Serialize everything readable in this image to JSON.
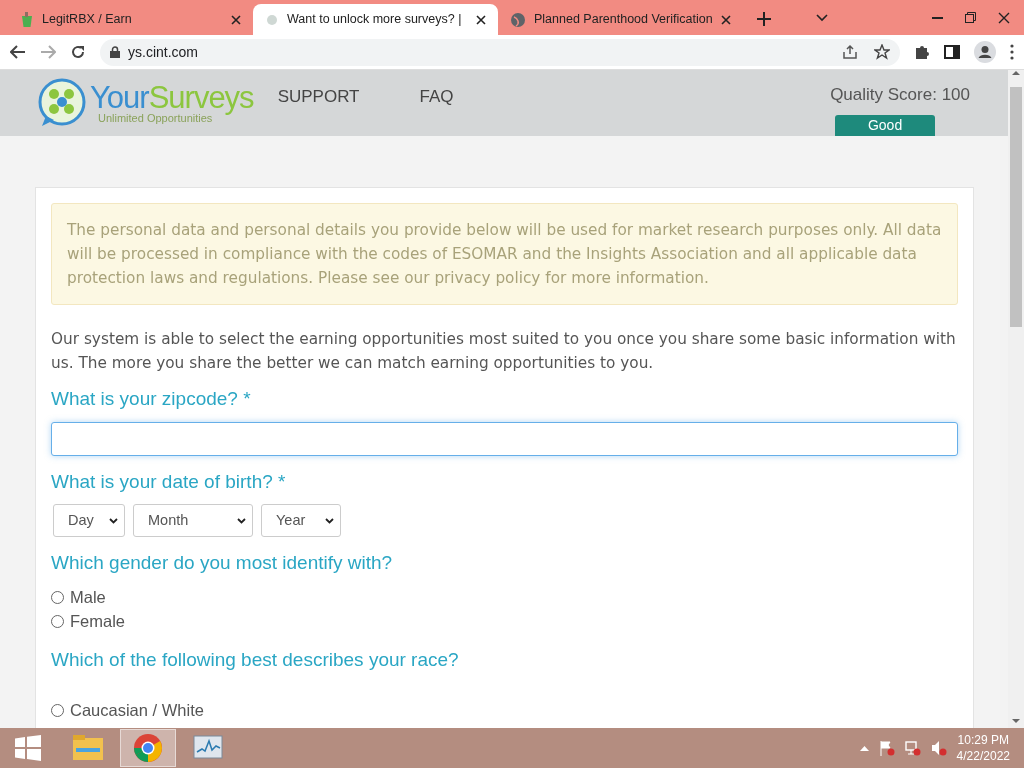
{
  "browser": {
    "tabs": [
      {
        "title": "LegitRBX / Earn",
        "kind": "bucket",
        "selected": false
      },
      {
        "title": "Want to unlock more surveys? |",
        "kind": "dot",
        "selected": true
      },
      {
        "title": "Planned Parenthood Verification",
        "kind": "globe",
        "selected": false
      }
    ],
    "address": "ys.cint.com"
  },
  "site_header": {
    "logo": {
      "word_1": "Your",
      "word_2": "Surveys",
      "tagline": "Unlimited Opportunities"
    },
    "nav": [
      "SUPPORT",
      "FAQ"
    ],
    "quality_score": "Quality Score: 100",
    "rating": "Good"
  },
  "notice": {
    "before": "The personal data and personal details you provide below will be used for market research purposes only. All data will be processed in compliance with the codes of ESOMAR and the Insights Association and all applicable data protection laws and regulations. Please see our ",
    "link": "privacy policy",
    "after": " for more information."
  },
  "intro": "Our system is able to select the earning opportunities most suited to you once you share some basic information with us. The more you share the better we can match earning opportunities to you.",
  "questions": [
    {
      "kind": "text",
      "label": "What is your zipcode? *",
      "focused": true
    },
    {
      "kind": "date",
      "label": "What is your date of birth? *",
      "selects": [
        "Day",
        "Month",
        "Year"
      ]
    },
    {
      "kind": "radio",
      "label": "Which gender do you most identify with?",
      "options": [
        {
          "label": "Male",
          "selected": false
        },
        {
          "label": "Female",
          "selected": false
        }
      ]
    },
    {
      "kind": "radio",
      "label": "Which of the following best describes your race?",
      "options": [
        {
          "label": "Caucasian / White",
          "selected": false
        }
      ]
    }
  ],
  "taskbar": {
    "apps": [
      {
        "kind": "explorer",
        "selected": false
      },
      {
        "kind": "chrome",
        "selected": true
      },
      {
        "kind": "monitor",
        "selected": false
      }
    ],
    "time": "10:29 PM",
    "date": "4/22/2022"
  }
}
